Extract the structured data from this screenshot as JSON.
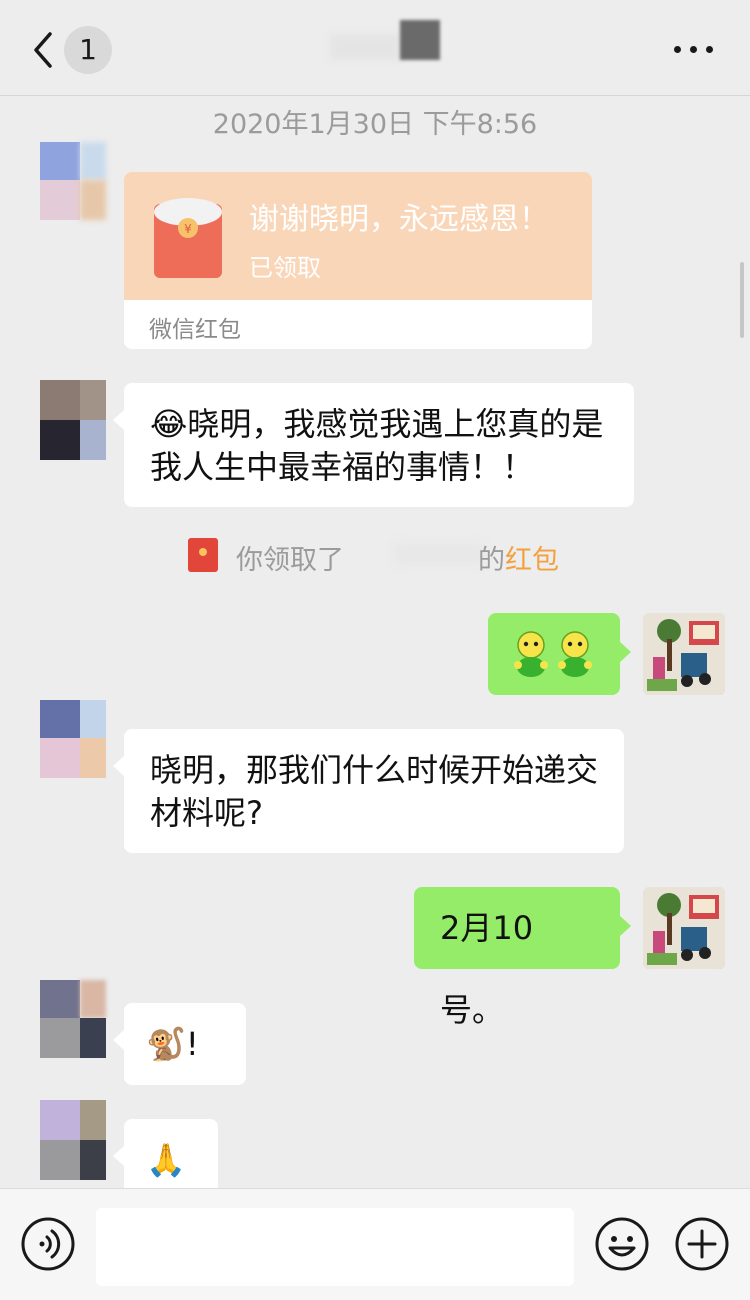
{
  "header": {
    "back_label": "back",
    "unread_count": "1"
  },
  "timestamp": "2020年1月30日 下午8:56",
  "red_packet": {
    "title": "谢谢晓明，永远感恩！",
    "status": "已领取",
    "footer": "微信红包",
    "color": "#f9d6b8"
  },
  "messages": [
    {
      "side": "left",
      "text": "😂晓明，我感觉我遇上您真的是我人生中最幸福的事情！！"
    },
    {
      "side": "right",
      "text": ""
    },
    {
      "side": "left",
      "text": "晓明，那我们什么时候开始递交材料呢?"
    },
    {
      "side": "right",
      "text": "2月10号。"
    },
    {
      "side": "left",
      "text": "🐒!"
    },
    {
      "side": "left",
      "text": "🙏"
    }
  ],
  "notice": {
    "prefix": "你领取了",
    "possessive": "的",
    "highlight": "红包"
  },
  "input_bar": {
    "placeholder": ""
  },
  "colors": {
    "background": "#ededed",
    "sent_bubble": "#95ec69",
    "received_bubble": "#ffffff",
    "accent_orange": "#f3a03e"
  }
}
